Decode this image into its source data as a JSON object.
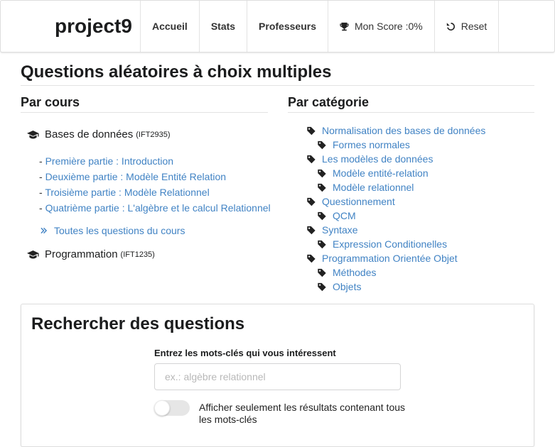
{
  "navbar": {
    "brand": "project9",
    "items": [
      {
        "label": "Accueil"
      },
      {
        "label": "Stats"
      },
      {
        "label": "Professeurs"
      },
      {
        "label": "Mon Score :0%",
        "icon": "trophy-icon"
      },
      {
        "label": "Reset",
        "icon": "undo-icon"
      }
    ]
  },
  "page": {
    "title": "Questions aléatoires à choix multiples"
  },
  "courses": {
    "header": "Par cours",
    "list": [
      {
        "name": "Bases de données",
        "code": "(IFT2935)",
        "chapters": [
          "Première partie : Introduction",
          "Deuxième partie : Modèle Entité Relation",
          "Troisième partie : Modèle Relationnel",
          "Quatrième partie : L'algèbre et le calcul Relationnel"
        ],
        "all_questions": "Toutes les questions du cours"
      },
      {
        "name": "Programmation",
        "code": "(IFT1235)"
      }
    ]
  },
  "categories": {
    "header": "Par catégorie",
    "items": [
      {
        "label": "Normalisation des bases de données",
        "level": 0
      },
      {
        "label": "Formes normales",
        "level": 1
      },
      {
        "label": "Les modèles de données",
        "level": 0
      },
      {
        "label": "Modèle entité-relation",
        "level": 1
      },
      {
        "label": "Modèle relationnel",
        "level": 1
      },
      {
        "label": "Questionnement",
        "level": 0
      },
      {
        "label": "QCM",
        "level": 1
      },
      {
        "label": "Syntaxe",
        "level": 0
      },
      {
        "label": "Expression Conditionelles",
        "level": 1
      },
      {
        "label": "Programmation Orientée Objet",
        "level": 0
      },
      {
        "label": "Méthodes",
        "level": 1
      },
      {
        "label": "Objets",
        "level": 1
      }
    ]
  },
  "search": {
    "title": "Rechercher des questions",
    "keywords_label": "Entrez les mots-clés qui vous intéressent",
    "keywords_placeholder": "ex.: algèbre relationnel",
    "keywords_value": "",
    "toggle_label": "Afficher seulement les résultats contenant tous les mots-clés",
    "toggle_on": false
  },
  "colors": {
    "link": "#4183c4",
    "text": "#1b1c1d"
  }
}
